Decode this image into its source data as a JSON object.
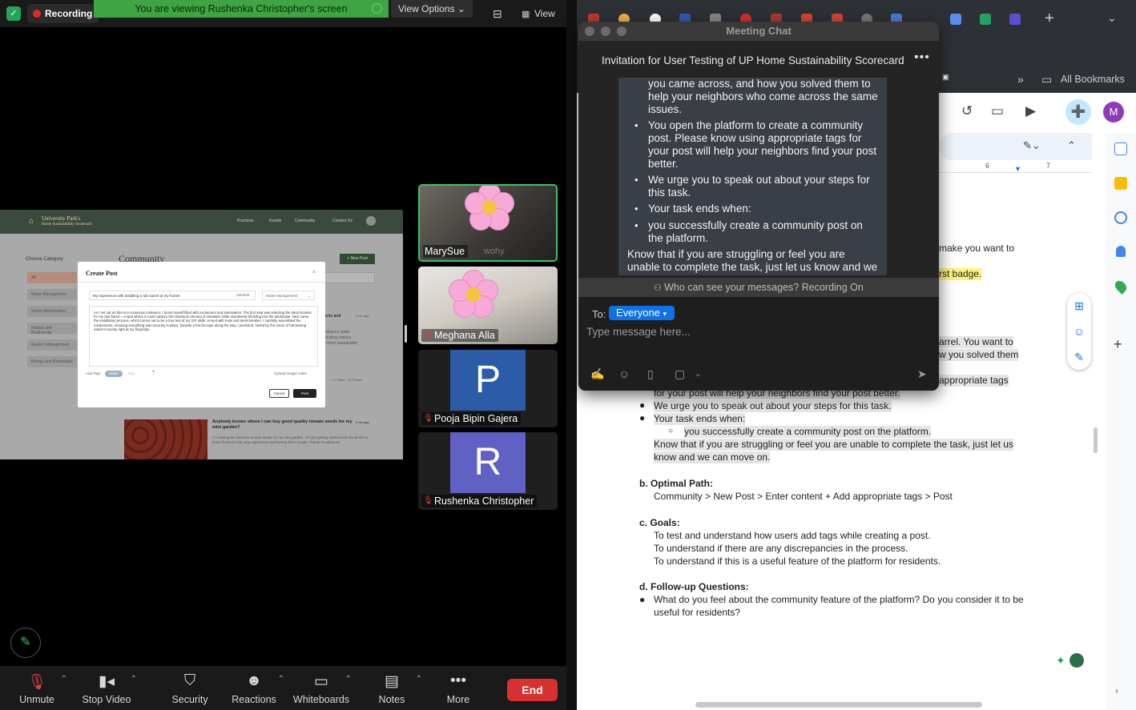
{
  "zoom": {
    "recording_label": "Recording",
    "viewing_banner": "You are viewing Rushenka Christopher's screen",
    "view_options_label": "View Options ⌄",
    "view_label": "View",
    "shared_screen": {
      "logo_line1": "University Park's",
      "logo_line2": "Home Sustainability Scorecard",
      "nav_links": [
        "Practices",
        "Events",
        "Community",
        "Contact Us"
      ],
      "choose_category": "Choose Category",
      "page_title": "Community",
      "new_post_label": "+ New Post",
      "categories": [
        "All",
        "Water Management",
        "Waste Minimization",
        "Habitat and Biodiversity",
        "Garden Management",
        "Energy and Renewable"
      ],
      "modal": {
        "title": "Create Post",
        "close": "×",
        "title_value": "My experience with installing a rain barrel at my home!",
        "char_count": "100/300",
        "tag_select": "Water Management",
        "body_text": "As I set out on this eco-conscious endeavor, I found myself filled with excitement and anticipation. The first step was selecting the ideal location for my rain barrel – a spot where it could capture the maximum amount of rainwater while seamlessly blending into the landscape. Next came the installation process, which turned out to be a true test of my DIY skills. Armed with tools and determination, I carefully assembled the components, ensuring everything was securely in place. Despite a few hiccups along the way, I persisted, fueled by the vision of harnessing nature's bounty right at my fingertips.",
        "add_tags": "Add Tags",
        "tag_chip": "Water",
        "tags_placeholder": "Tags",
        "upload": "Upload image/ video",
        "cancel": "Cancel",
        "post": "Post"
      },
      "side_snippets": [
        "forts and",
        "3 hrs ago",
        "enhance water",
        "exciting various",
        "g more sustainable",
        "♡ 17 likes  ◌ 5  ⊡ Save"
      ],
      "post_title": "Anybody knows where I can buy good quality tomato seeds for my mini garden?",
      "post_time": "2 hrs ago",
      "post_body": "I'm looking for heirloom tomato seeds for my mini garden. I'm just getting started and would like to know if anyone has any experience purchasing them locally. Thanks in advance!"
    },
    "participants": [
      {
        "name": "MarySue",
        "ghost": "wohy",
        "style": "video-flower",
        "muted": false,
        "active": true
      },
      {
        "name": "Meghana Alla",
        "style": "video-flower",
        "muted": true,
        "active": false
      },
      {
        "name": "Pooja Bipin Gajera",
        "initial": "P",
        "color": "#2c5ba8",
        "muted": true,
        "active": false
      },
      {
        "name": "Rushenka Christopher",
        "initial": "R",
        "color": "#6160c4",
        "muted": true,
        "active": false
      }
    ],
    "toolbar": {
      "unmute": "Unmute",
      "stop_video": "Stop Video",
      "security": "Security",
      "reactions": "Reactions",
      "whiteboards": "Whiteboards",
      "notes": "Notes",
      "more": "More",
      "end": "End"
    }
  },
  "chat": {
    "window_title": "Meeting Chat",
    "header": "Invitation for User Testing of UP Home Sustainability Scorecard",
    "more_icon": "•••",
    "message_lines": [
      "you came across, and how you solved them to",
      "help your neighbors who come across the same",
      "issues."
    ],
    "bullets": [
      [
        "You open the platform to create a community",
        "post. Please know using appropriate tags for",
        "your post will help your neighbors find your post",
        "better."
      ],
      [
        "We urge you to speak out about your steps for",
        "this task."
      ],
      [
        "Your task ends when:"
      ],
      [
        "you successfully create a community post on",
        "the platform."
      ]
    ],
    "closing_lines": [
      "Know that if you are struggling or feel you are",
      "unable to complete the task, just let us know and we"
    ],
    "who_can_see": "Who can see your messages? Recording On",
    "to_label": "To:",
    "to_value": "Everyone",
    "placeholder": "Type message here..."
  },
  "browser": {
    "all_bookmarks": "All Bookmarks",
    "ruler_marks": [
      "6",
      "7"
    ],
    "doc": {
      "partial_lines": [
        {
          "text": "make you want to",
          "hl": false
        },
        {
          "text": "rst badge.",
          "hl": "yellow"
        },
        {
          "text": "arrel. You want to",
          "hl": true
        },
        {
          "text": "w you solved them",
          "hl": true
        },
        {
          "text": "appropriate tags",
          "hl": true
        }
      ],
      "lines_after_chat": [
        "for your post will help your neighbors find your post better.",
        "We urge you to speak out about your steps for this task.",
        "Your task ends when:",
        "you successfully create a community post on the platform.",
        "Know that if you are struggling or feel you are unable to complete the task, just let us",
        "know and we can move on."
      ],
      "section_b": {
        "heading": "b.   Optimal Path:",
        "text": "Community > New Post > Enter content + Add appropriate tags > Post"
      },
      "section_c": {
        "heading": "c.   Goals:",
        "lines": [
          "To test and understand how users add tags while creating a post.",
          "To understand if there are any discrepancies in the process.",
          "To understand if this is a useful feature of the platform for residents."
        ]
      },
      "section_d": {
        "heading": "d.   Follow-up Questions:",
        "lines": [
          "What do you feel about the community feature of the platform? Do you consider it to be",
          "useful for residents?"
        ]
      }
    },
    "avatar_initial": "M"
  }
}
